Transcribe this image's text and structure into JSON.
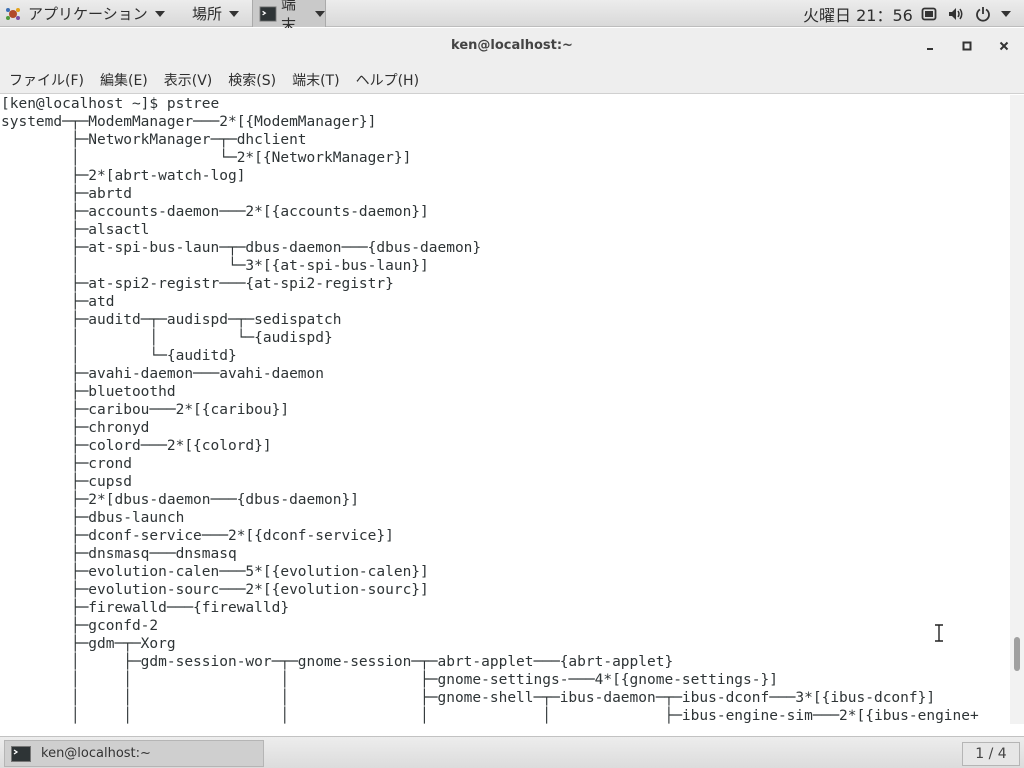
{
  "top_panel": {
    "apps_label": "アプリケーション",
    "places_label": "場所",
    "task_label": "端末",
    "clock": "火曜日 21：56",
    "icons": [
      "screen-icon",
      "volume-icon",
      "power-icon"
    ]
  },
  "window": {
    "title": "ken@localhost:~",
    "buttons": [
      "minimize-icon",
      "maximize-icon",
      "close-icon"
    ]
  },
  "menu": [
    "ファイル(F)",
    "編集(E)",
    "表示(V)",
    "検索(S)",
    "端末(T)",
    "ヘルプ(H)"
  ],
  "terminal": {
    "lines": [
      "[ken@localhost ~]$ pstree",
      "systemd─┬─ModemManager───2*[{ModemManager}]",
      "        ├─NetworkManager─┬─dhclient",
      "        │                └─2*[{NetworkManager}]",
      "        ├─2*[abrt-watch-log]",
      "        ├─abrtd",
      "        ├─accounts-daemon───2*[{accounts-daemon}]",
      "        ├─alsactl",
      "        ├─at-spi-bus-laun─┬─dbus-daemon───{dbus-daemon}",
      "        │                 └─3*[{at-spi-bus-laun}]",
      "        ├─at-spi2-registr───{at-spi2-registr}",
      "        ├─atd",
      "        ├─auditd─┬─audispd─┬─sedispatch",
      "        │        │         └─{audispd}",
      "        │        └─{auditd}",
      "        ├─avahi-daemon───avahi-daemon",
      "        ├─bluetoothd",
      "        ├─caribou───2*[{caribou}]",
      "        ├─chronyd",
      "        ├─colord───2*[{colord}]",
      "        ├─crond",
      "        ├─cupsd",
      "        ├─2*[dbus-daemon───{dbus-daemon}]",
      "        ├─dbus-launch",
      "        ├─dconf-service───2*[{dconf-service}]",
      "        ├─dnsmasq───dnsmasq",
      "        ├─evolution-calen───5*[{evolution-calen}]",
      "        ├─evolution-sourc───2*[{evolution-sourc}]",
      "        ├─firewalld───{firewalld}",
      "        ├─gconfd-2",
      "        ├─gdm─┬─Xorg",
      "        │     ├─gdm-session-wor─┬─gnome-session─┬─abrt-applet───{abrt-applet}",
      "        │     │                 │               ├─gnome-settings-───4*[{gnome-settings-}]",
      "        │     │                 │               ├─gnome-shell─┬─ibus-daemon─┬─ibus-dconf───3*[{ibus-dconf}]",
      "        │     │                 │               │             │             ├─ibus-engine-sim───2*[{ibus-engine+"
    ]
  },
  "bottom_bar": {
    "task_label": "ken@localhost:~",
    "workspace": "1 / 4"
  }
}
